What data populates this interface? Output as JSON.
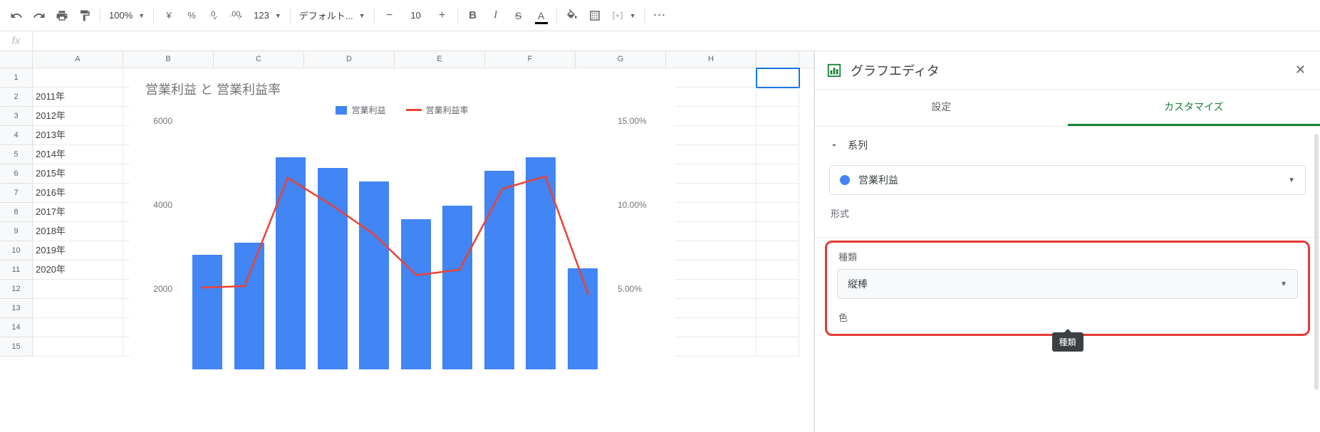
{
  "toolbar": {
    "zoom": "100%",
    "currency": "¥",
    "percent": "%",
    "dec_dec": ".0",
    "dec_inc": ".00",
    "more_formats": "123",
    "font": "デフォルト...",
    "font_size": "10"
  },
  "columns": [
    "A",
    "B",
    "C",
    "D",
    "E",
    "F",
    "G",
    "H"
  ],
  "row_numbers": [
    "1",
    "2",
    "3",
    "4",
    "5",
    "6",
    "7",
    "8",
    "9",
    "10",
    "11",
    "12",
    "13",
    "14",
    "15"
  ],
  "cells_a": [
    "",
    "2011年",
    "2012年",
    "2013年",
    "2014年",
    "2015年",
    "2016年",
    "2017年",
    "2018年",
    "2019年",
    "2020年",
    "",
    "",
    "",
    ""
  ],
  "chart_data": {
    "type": "combo",
    "title": "営業利益 と 営業利益率",
    "series": [
      {
        "name": "営業利益",
        "type": "bar",
        "values": [
          2950,
          3250,
          5450,
          5180,
          4820,
          3860,
          4200,
          5100,
          5450,
          2600
        ]
      },
      {
        "name": "営業利益率",
        "type": "line",
        "values": [
          5.25,
          5.35,
          12.3,
          10.6,
          8.7,
          6.05,
          6.4,
          11.6,
          12.4,
          4.8
        ]
      }
    ],
    "categories": [
      "2011年",
      "2012年",
      "2013年",
      "2014年",
      "2015年",
      "2016年",
      "2017年",
      "2018年",
      "2019年",
      "2020年"
    ],
    "y1": {
      "ticks": [
        2000,
        4000,
        6000
      ],
      "min": 0,
      "max": 6400
    },
    "y2": {
      "ticks": [
        "5.00%",
        "10.00%",
        "15.00%"
      ],
      "min": 0,
      "max": 16
    }
  },
  "sidebar": {
    "title": "グラフエディタ",
    "tabs": {
      "setup": "設定",
      "customize": "カスタマイズ"
    },
    "section_series": "系列",
    "series_selected": "営業利益",
    "format_label": "形式",
    "type_label": "種類",
    "type_value": "縦棒",
    "tooltip": "種類",
    "color_label": "色"
  }
}
